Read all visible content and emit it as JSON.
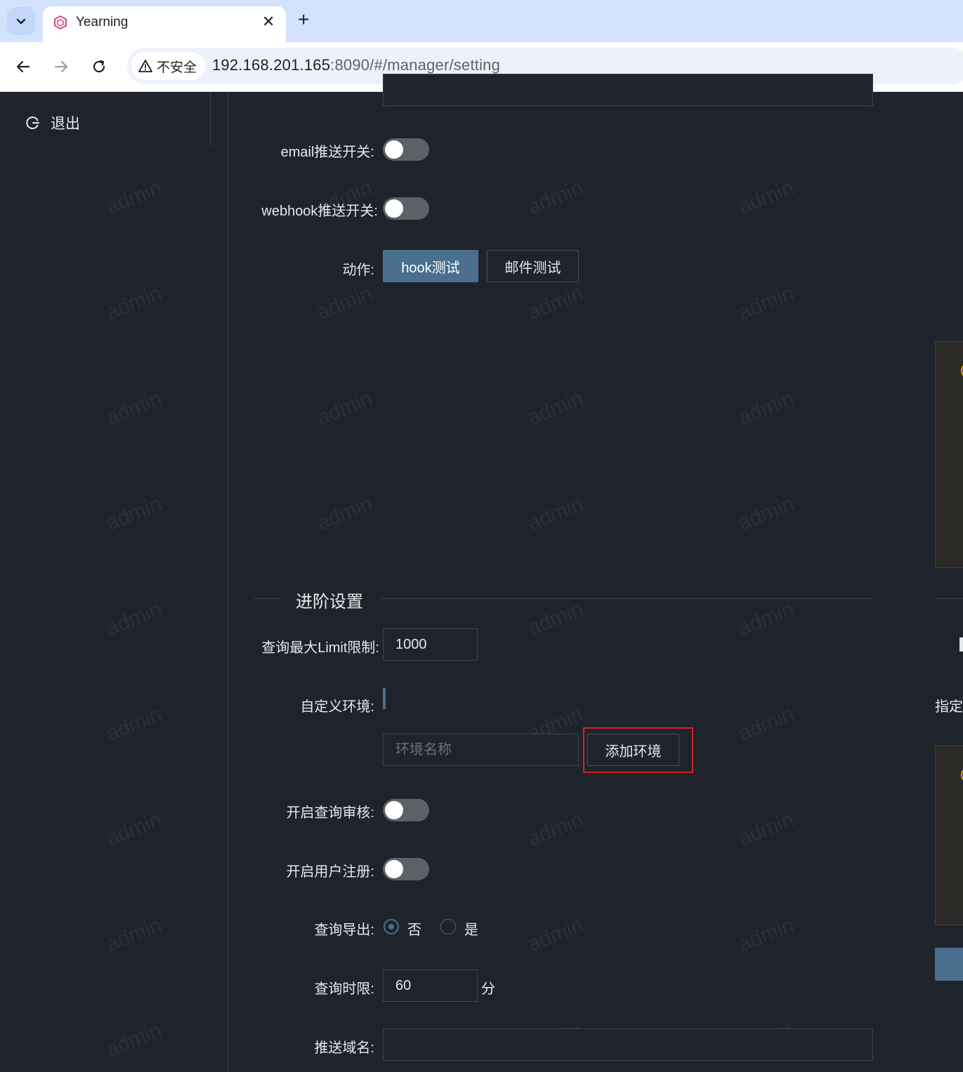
{
  "browser": {
    "tab_title": "Yearning",
    "security_label": "不安全",
    "url_host": "192.168.201.165",
    "url_rest": ":8090/#/manager/setting"
  },
  "sidebar": {
    "logout_label": "退出"
  },
  "settings": {
    "email_push_label": "email推送开关:",
    "email_push_on": false,
    "webhook_push_label": "webhook推送开关:",
    "webhook_push_on": false,
    "action_label": "动作:",
    "hook_test_label": "hook测试",
    "mail_test_label": "邮件测试"
  },
  "advanced": {
    "section_title": "进阶设置",
    "limit_label": "查询最大Limit限制:",
    "limit_value": "1000",
    "custom_env_label": "自定义环境:",
    "env_name_placeholder": "环境名称",
    "add_env_label": "添加环境",
    "query_audit_label": "开启查询审核:",
    "query_audit_on": false,
    "user_register_label": "开启用户注册:",
    "user_register_on": false,
    "export_label": "查询导出:",
    "export_options": [
      "否",
      "是"
    ],
    "export_selected": "否",
    "time_limit_label": "查询时限:",
    "time_limit_value": "60",
    "time_limit_unit": "分",
    "push_domain_label": "推送域名:",
    "push_domain_value": ""
  },
  "right_column": {
    "assign_label": "指定"
  },
  "watermark_text": "admin"
}
